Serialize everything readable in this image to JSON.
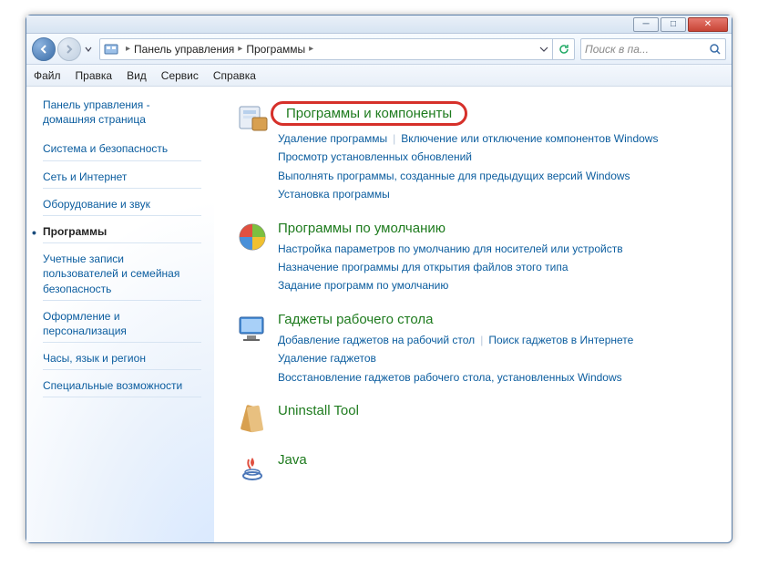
{
  "title": "",
  "breadcrumb": {
    "part1": "Панель управления",
    "part2": "Программы"
  },
  "search": {
    "placeholder": "Поиск в па..."
  },
  "menu": {
    "file": "Файл",
    "edit": "Правка",
    "view": "Вид",
    "service": "Сервис",
    "help": "Справка"
  },
  "sidebar": {
    "home": "Панель управления - домашняя страница",
    "items": [
      {
        "label": "Система и безопасность"
      },
      {
        "label": "Сеть и Интернет"
      },
      {
        "label": "Оборудование и звук"
      },
      {
        "label": "Программы"
      },
      {
        "label": "Учетные записи пользователей и семейная безопасность"
      },
      {
        "label": "Оформление и персонализация"
      },
      {
        "label": "Часы, язык и регион"
      },
      {
        "label": "Специальные возможности"
      }
    ]
  },
  "sections": [
    {
      "title": "Программы и компоненты",
      "links": [
        "Удаление программы",
        "Включение или отключение компонентов Windows",
        "Просмотр установленных обновлений",
        "Выполнять программы, созданные для предыдущих версий Windows",
        "Установка программы"
      ]
    },
    {
      "title": "Программы по умолчанию",
      "links": [
        "Настройка параметров по умолчанию для носителей или устройств",
        "Назначение программы для открытия файлов этого типа",
        "Задание программ по умолчанию"
      ]
    },
    {
      "title": "Гаджеты рабочего стола",
      "links": [
        "Добавление гаджетов на рабочий стол",
        "Поиск гаджетов в Интернете",
        "Удаление гаджетов",
        "Восстановление гаджетов рабочего стола, установленных Windows"
      ]
    },
    {
      "title": "Uninstall Tool",
      "links": []
    },
    {
      "title": "Java",
      "links": []
    }
  ]
}
